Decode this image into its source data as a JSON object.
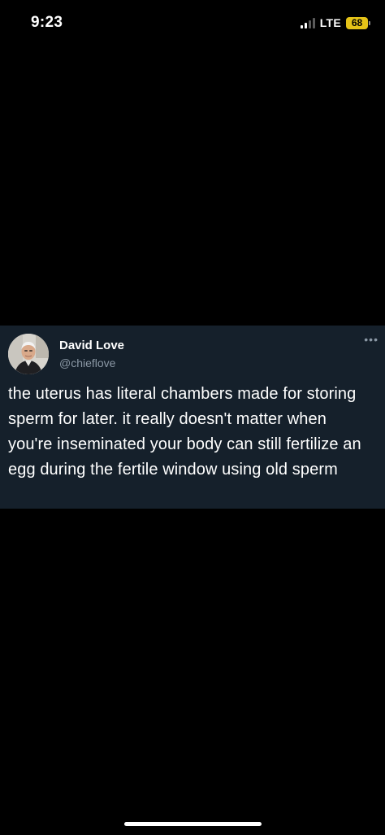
{
  "status_bar": {
    "time": "9:23",
    "network": "LTE",
    "battery": "68",
    "battery_color": "#e5c318",
    "signal_bars_active": 2
  },
  "tweet": {
    "author_name": "David Love",
    "author_handle": "@chieflove",
    "more_icon": "more-horizontal-icon",
    "text": "the uterus has literal chambers made for storing sperm for later. it really doesn't matter when you're inseminated your body can still fertilize an egg during the fertile window using old sperm",
    "background_color": "#15202b",
    "handle_color": "#8b98a5"
  }
}
